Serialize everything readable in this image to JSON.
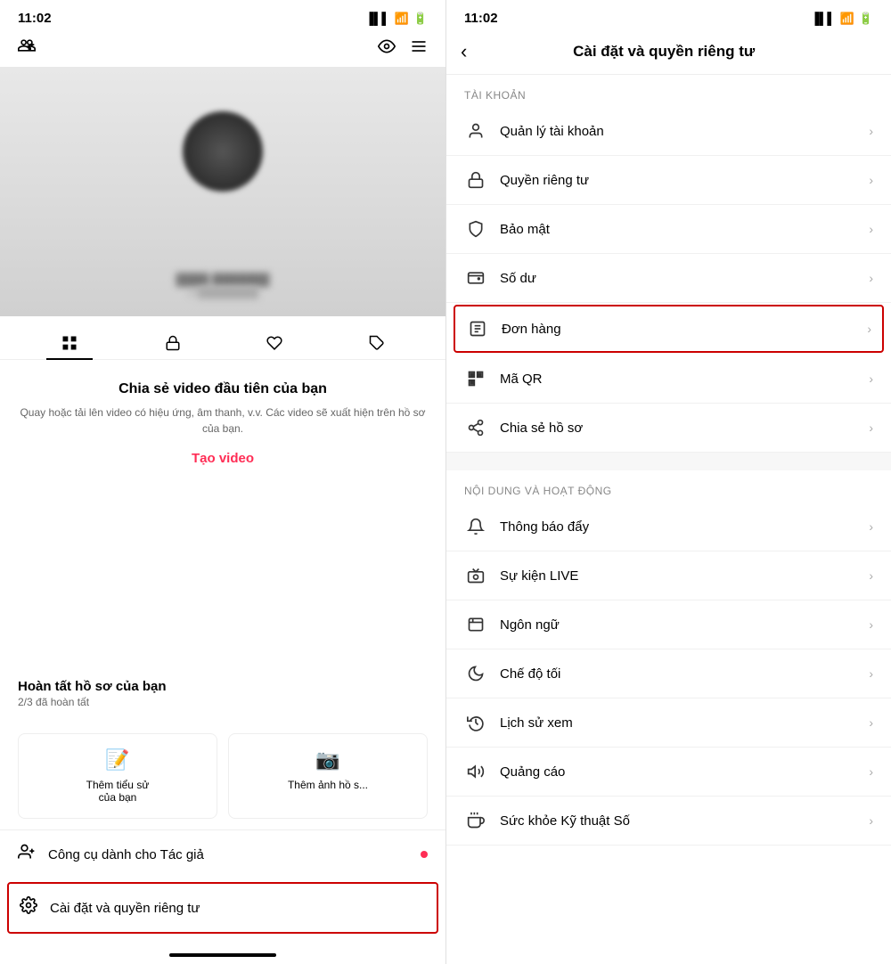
{
  "left": {
    "time": "11:02",
    "nav": {
      "add_user_icon": "person-add",
      "eye_icon": "eye",
      "menu_icon": "menu"
    },
    "tabs": [
      {
        "label": "grid",
        "active": true
      },
      {
        "label": "lock"
      },
      {
        "label": "heart"
      },
      {
        "label": "tag"
      }
    ],
    "profile_section": {
      "title": "Chia sẻ video đầu tiên của bạn",
      "description": "Quay hoặc tải lên video có hiệu ứng, âm thanh, v.v. Các video sẽ xuất hiện trên hồ sơ của bạn.",
      "create_btn": "Tạo video"
    },
    "completion": {
      "title": "Hoàn tất hồ sơ của bạn",
      "subtitle": "2/3 đã hoàn tất"
    },
    "cards": [
      {
        "icon": "📝",
        "label": "Thêm tiểu sử của bạn"
      },
      {
        "icon": "📷",
        "label": "Thêm ảnh hồ s..."
      }
    ],
    "menu_items": [
      {
        "icon": "⚙️",
        "label": "Công cụ dành cho Tác giả",
        "has_dot": true
      },
      {
        "icon": "⚙️",
        "label": "Cài đặt và quyền riêng tư",
        "highlighted": true
      }
    ]
  },
  "right": {
    "time": "11:02",
    "back_label": "‹",
    "title": "Cài đặt và quyền riêng tư",
    "sections": [
      {
        "header": "TÀI KHOẢN",
        "items": [
          {
            "icon": "person",
            "label": "Quản lý tài khoản"
          },
          {
            "icon": "lock",
            "label": "Quyền riêng tư"
          },
          {
            "icon": "shield",
            "label": "Bảo mật"
          },
          {
            "icon": "wallet",
            "label": "Số dư"
          },
          {
            "icon": "orders",
            "label": "Đơn hàng",
            "highlighted": true
          },
          {
            "icon": "qr",
            "label": "Mã QR"
          },
          {
            "icon": "share",
            "label": "Chia sẻ hồ sơ"
          }
        ]
      },
      {
        "header": "NỘI DUNG VÀ HOẠT ĐỘNG",
        "items": [
          {
            "icon": "bell",
            "label": "Thông báo đẩy"
          },
          {
            "icon": "live",
            "label": "Sự kiện LIVE"
          },
          {
            "icon": "lang",
            "label": "Ngôn ngữ"
          },
          {
            "icon": "moon",
            "label": "Chế độ tối"
          },
          {
            "icon": "history",
            "label": "Lịch sử xem"
          },
          {
            "icon": "ads",
            "label": "Quảng cáo"
          },
          {
            "icon": "digital",
            "label": "Sức khỏe Kỹ thuật Số"
          }
        ]
      }
    ]
  }
}
